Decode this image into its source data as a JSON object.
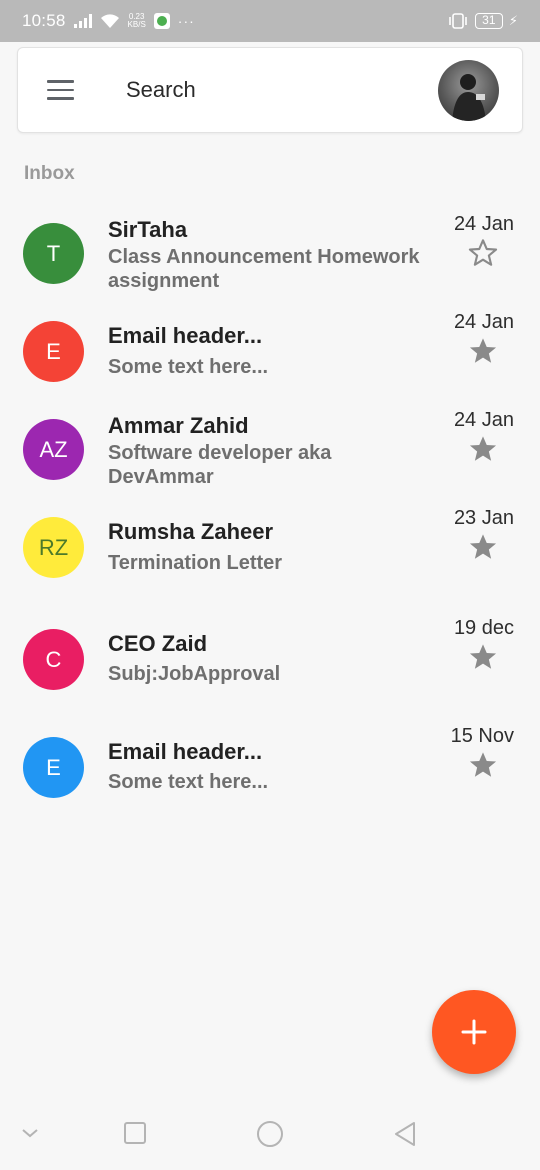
{
  "status_bar": {
    "time": "10:58",
    "speed_value": "0.23",
    "speed_unit": "KB/S",
    "battery": "31",
    "more": "···"
  },
  "search": {
    "placeholder": "Search"
  },
  "section_label": "Inbox",
  "mails": [
    {
      "initials": "T",
      "avatar_color": "#388e3c",
      "initials_color": "#ffffff",
      "sender": "SirTaha",
      "subject": "Class Announcement Homework assignment",
      "date": "24 Jan",
      "starred": false
    },
    {
      "initials": "E",
      "avatar_color": "#f44336",
      "initials_color": "#ffffff",
      "sender": "Email header...",
      "subject": "Some text here...",
      "date": "24 Jan",
      "starred": true
    },
    {
      "initials": "AZ",
      "avatar_color": "#9c27b0",
      "initials_color": "#ffffff",
      "sender": "Ammar Zahid",
      "subject": "Software developer aka DevAmmar",
      "date": "24 Jan",
      "starred": true
    },
    {
      "initials": "RZ",
      "avatar_color": "#ffeb3b",
      "initials_color": "#4c7a2a",
      "sender": "Rumsha Zaheer",
      "subject": "Termination Letter",
      "date": "23 Jan",
      "starred": true
    },
    {
      "initials": "C",
      "avatar_color": "#e91e63",
      "initials_color": "#ffffff",
      "sender": "CEO Zaid",
      "subject": "Subj:JobApproval",
      "date": "19 dec",
      "starred": true
    },
    {
      "initials": "E",
      "avatar_color": "#2196f3",
      "initials_color": "#ffffff",
      "sender": "Email header...",
      "subject": "Some text here...",
      "date": "15 Nov",
      "starred": true
    }
  ],
  "colors": {
    "fab": "#ff5722",
    "star_filled": "#8a8a8a",
    "star_outline": "#8a8a8a"
  },
  "icons": {
    "menu": "menu-icon",
    "compose": "plus-icon",
    "star": "star-icon",
    "nav_down": "chevron-down-icon",
    "nav_recents": "square-icon",
    "nav_home": "circle-icon",
    "nav_back": "triangle-back-icon"
  }
}
